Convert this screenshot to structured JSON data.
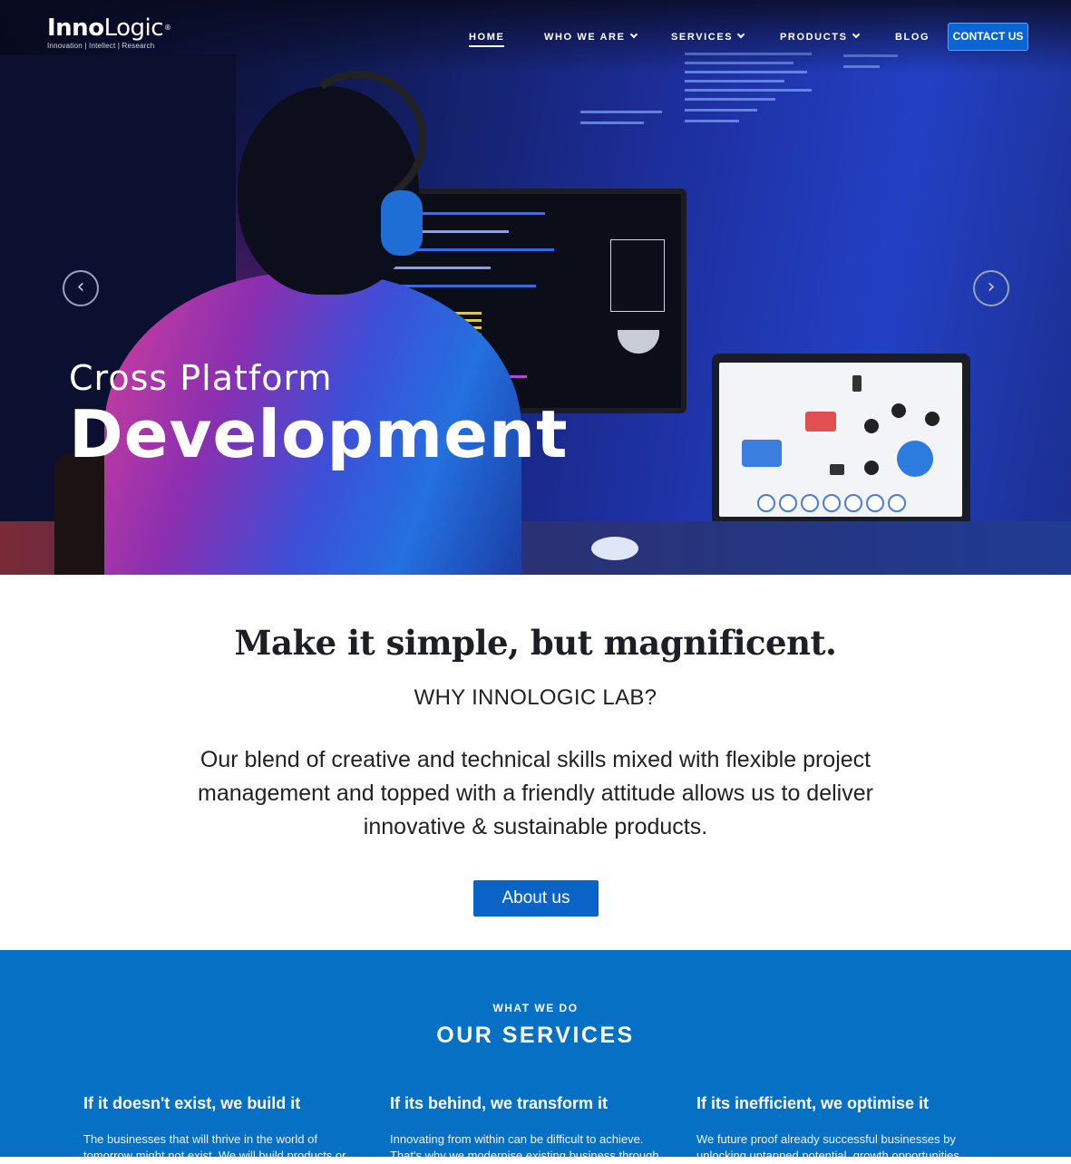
{
  "nav": {
    "logo_main_bold": "Inno",
    "logo_main_rest": "Logic",
    "logo_reg": "®",
    "logo_tagline": "Innovation | Intellect | Research",
    "items": [
      {
        "label": "HOME"
      },
      {
        "label": "WHO WE ARE"
      },
      {
        "label": "SERVICES"
      },
      {
        "label": "PRODUCTS"
      },
      {
        "label": "BLOG"
      }
    ],
    "contact_label": "CONTACT US"
  },
  "hero": {
    "subtitle": "Cross Platform",
    "title": "Development",
    "prev_icon": "‹",
    "next_icon": "›"
  },
  "intro": {
    "tagline": "Make it simple, but magnificent.",
    "heading": "WHY INNOLOGIC LAB?",
    "blurb": "Our blend of creative and technical skills mixed with flexible project management and topped with a friendly attitude allows us to deliver innovative & sustainable products.",
    "button_label": "About us"
  },
  "services": {
    "eyebrow": "WHAT WE DO",
    "title": "OUR SERVICES",
    "columns": [
      {
        "heading": "If it doesn't exist, we build it",
        "text": "The businesses that will thrive in the world of tomorrow might not exist. We will build products or"
      },
      {
        "heading": "If its behind, we transform it",
        "text": "Innovating from within can be difficult to achieve. That's why we modernise existing business through"
      },
      {
        "heading": "If its inefficient, we optimise it",
        "text": "We future proof already successful businesses by unlocking untapped potential, growth opportunities"
      }
    ]
  },
  "colors": {
    "accent": "#0570c4",
    "button": "#0a64c8",
    "hero_dark": "#101a52"
  },
  "icons": {
    "prev": "chevron-left-icon",
    "next": "chevron-right-icon",
    "caret": "chevron-down-icon"
  }
}
